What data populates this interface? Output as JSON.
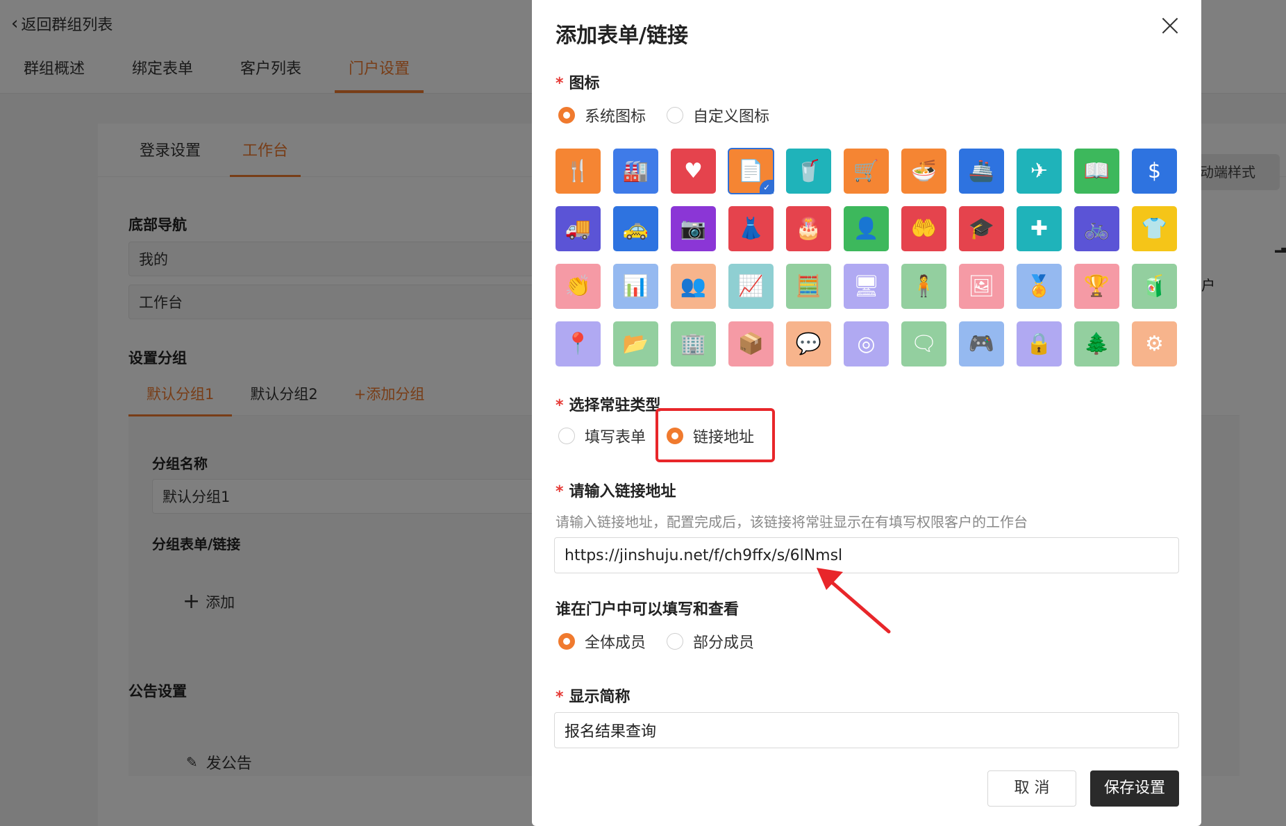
{
  "page": {
    "back_label": "返回群组列表",
    "tabs": [
      "群组概述",
      "绑定表单",
      "客户列表",
      "门户设置"
    ],
    "subtabs": [
      "登录设置",
      "工作台"
    ],
    "bottom_nav_title": "底部导航",
    "bottom_nav_items": [
      "我的",
      "工作台"
    ],
    "group_settings_title": "设置分组",
    "group_tabs": [
      "默认分组1",
      "默认分组2"
    ],
    "add_group_label": "+添加分组",
    "group_name_label": "分组名称",
    "group_name_value": "默认分组1",
    "group_forms_label": "分组表单/链接",
    "add_label": "添加",
    "notice_title": "公告设置",
    "post_notice_label": "发公告",
    "right_button_fragment": "动端样式",
    "right_text_fragment": "户"
  },
  "modal": {
    "title": "添加表单/链接",
    "icon_label": "图标",
    "icon_options": [
      "系统图标",
      "自定义图标"
    ],
    "icon_selected": "系统图标",
    "icons": [
      {
        "name": "fork-knife-icon",
        "color": "#f58533",
        "glyph": "🍴"
      },
      {
        "name": "factory-icon",
        "color": "#3f7be8",
        "glyph": "🏭"
      },
      {
        "name": "heart-icon",
        "color": "#e5434d",
        "glyph": "♥"
      },
      {
        "name": "document-icon",
        "color": "#f58533",
        "glyph": "📄",
        "selected": true
      },
      {
        "name": "cup-icon",
        "color": "#1fb3ba",
        "glyph": "🥤"
      },
      {
        "name": "cart-icon",
        "color": "#f58533",
        "glyph": "🛒"
      },
      {
        "name": "bowl-icon",
        "color": "#f58533",
        "glyph": "🍜"
      },
      {
        "name": "ship-icon",
        "color": "#2e73e0",
        "glyph": "🚢"
      },
      {
        "name": "airplane-icon",
        "color": "#1fb3ba",
        "glyph": "✈"
      },
      {
        "name": "book-icon",
        "color": "#3db85c",
        "glyph": "📖"
      },
      {
        "name": "dollar-icon",
        "color": "#2e73e0",
        "glyph": "$"
      },
      {
        "name": "truck-icon",
        "color": "#5b54d6",
        "glyph": "🚚"
      },
      {
        "name": "taxi-icon",
        "color": "#2e73e0",
        "glyph": "🚕"
      },
      {
        "name": "camera-icon",
        "color": "#8b36d6",
        "glyph": "📷"
      },
      {
        "name": "dress-icon",
        "color": "#e5434d",
        "glyph": "👗"
      },
      {
        "name": "cake-icon",
        "color": "#e5434d",
        "glyph": "🎂"
      },
      {
        "name": "person-icon",
        "color": "#3db85c",
        "glyph": "👤"
      },
      {
        "name": "hand-heart-icon",
        "color": "#e5434d",
        "glyph": "🤲"
      },
      {
        "name": "graduation-cap-icon",
        "color": "#e5434d",
        "glyph": "🎓"
      },
      {
        "name": "medical-kit-icon",
        "color": "#1fb3ba",
        "glyph": "✚"
      },
      {
        "name": "bicycle-icon",
        "color": "#5b54d6",
        "glyph": "🚲"
      },
      {
        "name": "tshirt-icon",
        "color": "#f5c518",
        "glyph": "👕"
      },
      {
        "name": "clap-icon",
        "color": "#f59aa5",
        "glyph": "👏"
      },
      {
        "name": "bar-chart-icon",
        "color": "#95b9f0",
        "glyph": "📊"
      },
      {
        "name": "meeting-icon",
        "color": "#f7b48c",
        "glyph": "👥"
      },
      {
        "name": "presentation-icon",
        "color": "#8fcfd2",
        "glyph": "📈"
      },
      {
        "name": "calculator-icon",
        "color": "#93cf9f",
        "glyph": "🧮"
      },
      {
        "name": "monitor-user-icon",
        "color": "#b0a9f2",
        "glyph": "🖥"
      },
      {
        "name": "people-icon",
        "color": "#93cf9f",
        "glyph": "🧍"
      },
      {
        "name": "picture-icon",
        "color": "#f59aa5",
        "glyph": "🖼"
      },
      {
        "name": "medal-icon",
        "color": "#95b9f0",
        "glyph": "🏅"
      },
      {
        "name": "laurel-icon",
        "color": "#f59aa5",
        "glyph": "🏆"
      },
      {
        "name": "drink-icon",
        "color": "#93cf9f",
        "glyph": "🧃"
      },
      {
        "name": "map-pin-tree-icon",
        "color": "#b0a9f2",
        "glyph": "📍"
      },
      {
        "name": "folder-icon",
        "color": "#93cf9f",
        "glyph": "📂"
      },
      {
        "name": "building-icon",
        "color": "#93cf9f",
        "glyph": "🏢"
      },
      {
        "name": "open-box-icon",
        "color": "#f59aa5",
        "glyph": "📦"
      },
      {
        "name": "chat-check-icon",
        "color": "#f7b48c",
        "glyph": "💬"
      },
      {
        "name": "fingerprint-icon",
        "color": "#b0a9f2",
        "glyph": "◎"
      },
      {
        "name": "message-board-icon",
        "color": "#93cf9f",
        "glyph": "🗨"
      },
      {
        "name": "gamepad-music-icon",
        "color": "#95b9f0",
        "glyph": "🎮"
      },
      {
        "name": "lock-hand-icon",
        "color": "#b0a9f2",
        "glyph": "🔒"
      },
      {
        "name": "pine-tree-icon",
        "color": "#93cf9f",
        "glyph": "🌲"
      },
      {
        "name": "toggle-icon",
        "color": "#f7b48c",
        "glyph": "⚙"
      }
    ],
    "type_label": "选择常驻类型",
    "type_options": [
      "填写表单",
      "链接地址"
    ],
    "type_selected": "链接地址",
    "link_label": "请输入链接地址",
    "link_hint": "请输入链接地址，配置完成后，该链接将常驻显示在有填写权限客户的工作台",
    "link_value": "https://jinshuju.net/f/ch9ffx/s/6lNmsl",
    "who_label": "谁在门户中可以填写和查看",
    "who_options": [
      "全体成员",
      "部分成员"
    ],
    "who_selected": "全体成员",
    "short_name_label": "显示简称",
    "short_name_value": "报名结果查询",
    "cancel_label": "取 消",
    "save_label": "保存设置"
  },
  "colors": {
    "accent": "#f07a2e",
    "required": "#e53935",
    "highlight_box": "#e8262a",
    "save_button": "#2a2a2a"
  }
}
